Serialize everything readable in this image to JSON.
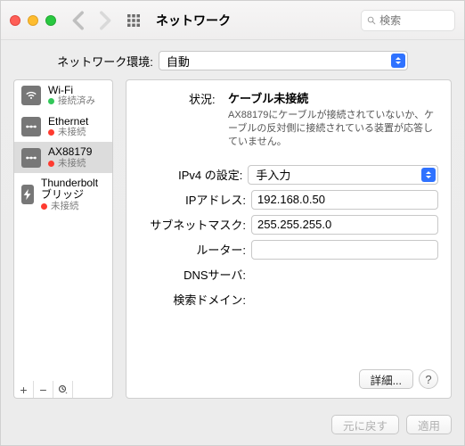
{
  "titlebar": {
    "title": "ネットワーク",
    "search_placeholder": "検索"
  },
  "location": {
    "label": "ネットワーク環境:",
    "value": "自動"
  },
  "sidebar": {
    "items": [
      {
        "name": "Wi-Fi",
        "status": "接続済み",
        "dot": "green",
        "icon": "wifi"
      },
      {
        "name": "Ethernet",
        "status": "未接続",
        "dot": "red",
        "icon": "ethernet"
      },
      {
        "name": "AX88179",
        "status": "未接続",
        "dot": "red",
        "icon": "ethernet",
        "selected": true
      },
      {
        "name": "Thunderbolt ブリッジ",
        "status": "未接続",
        "dot": "red",
        "icon": "thunderbolt"
      }
    ]
  },
  "detail": {
    "status_label": "状況:",
    "status_main": "ケーブル未接続",
    "status_sub": "AX88179にケーブルが接続されていないか、ケーブルの反対側に接続されている装置が応答していません。",
    "fields": {
      "ipv4_config_label": "IPv4 の設定:",
      "ipv4_config_value": "手入力",
      "ip_label": "IPアドレス:",
      "ip_value": "192.168.0.50",
      "subnet_label": "サブネットマスク:",
      "subnet_value": "255.255.255.0",
      "router_label": "ルーター:",
      "router_value": "",
      "dns_label": "DNSサーバ:",
      "dns_value": "",
      "search_label": "検索ドメイン:",
      "search_value": ""
    },
    "advanced_label": "詳細..."
  },
  "buttons": {
    "revert": "元に戻す",
    "apply": "適用"
  }
}
